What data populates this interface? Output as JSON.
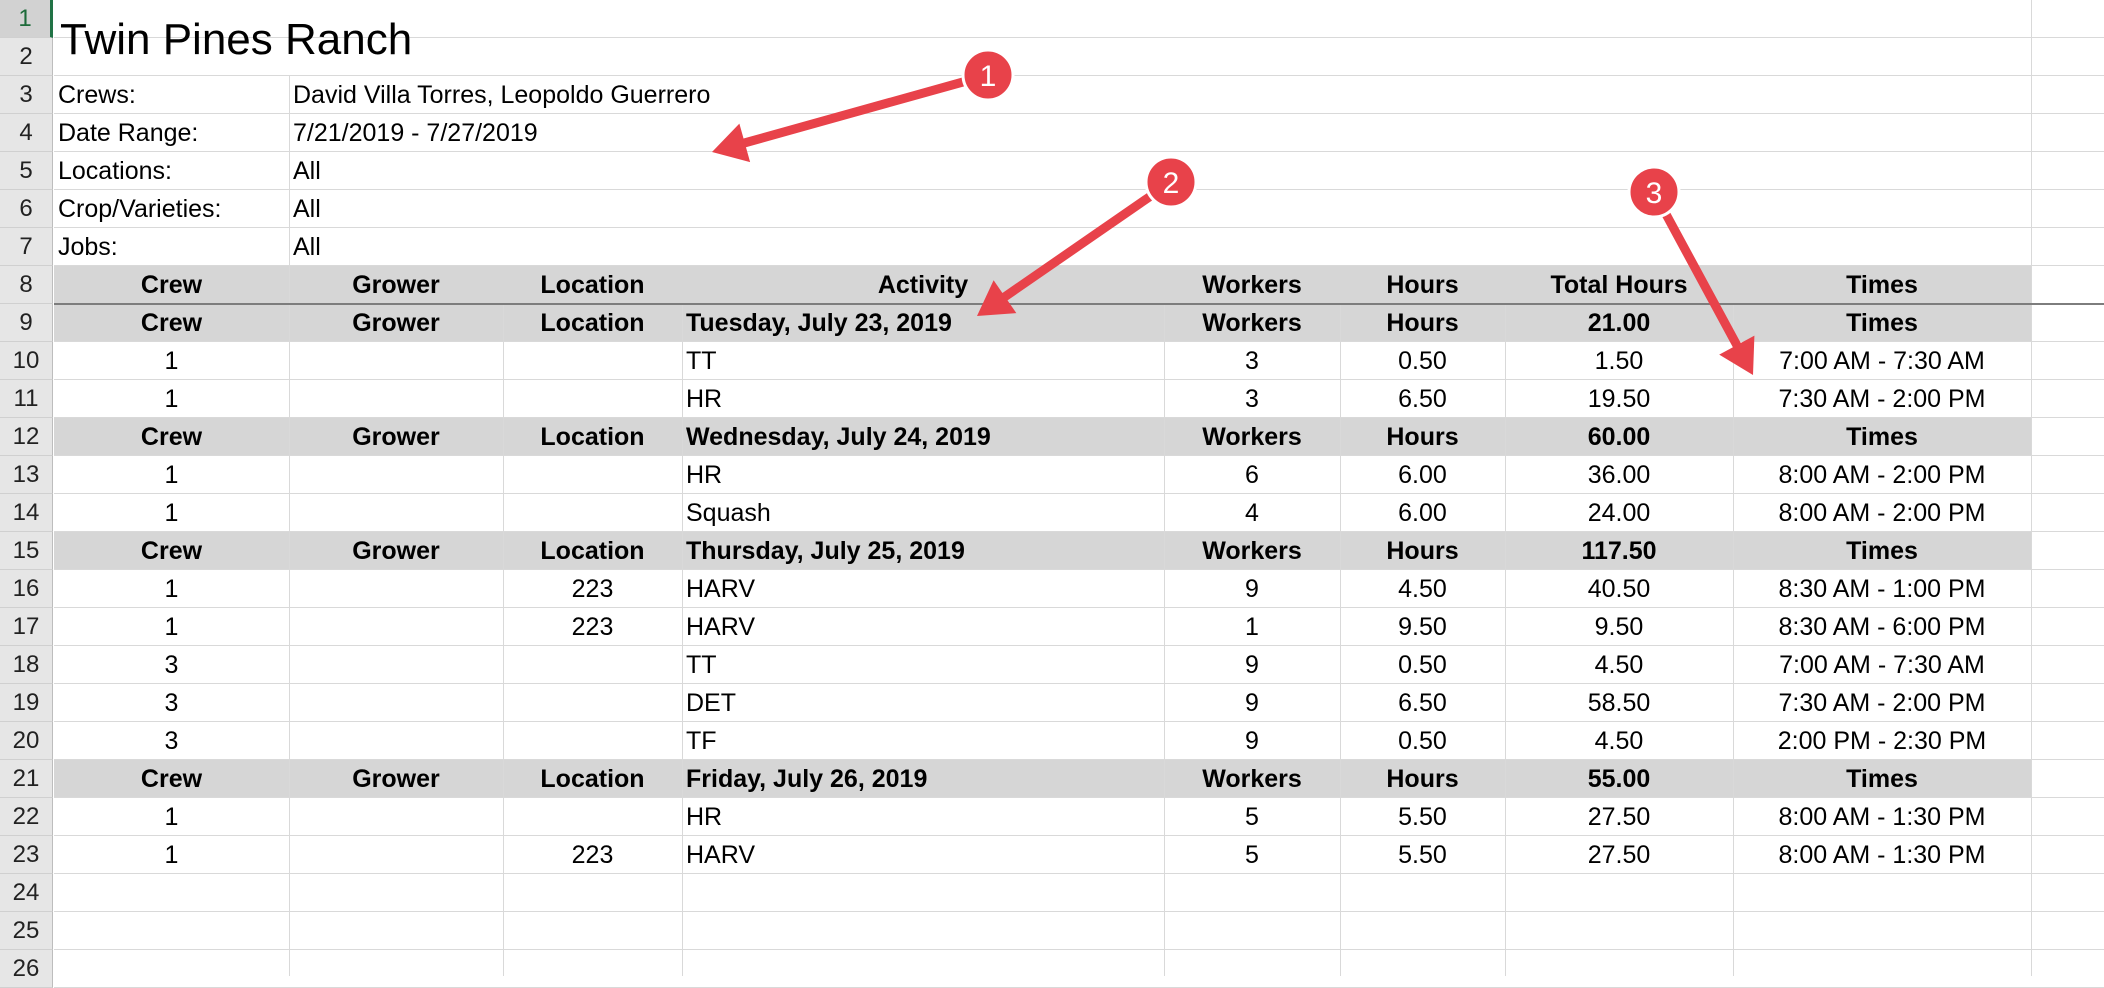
{
  "row_numbers": [
    "1",
    "2",
    "3",
    "4",
    "5",
    "6",
    "7",
    "8",
    "9",
    "10",
    "11",
    "12",
    "13",
    "14",
    "15",
    "16",
    "17",
    "18",
    "19",
    "20",
    "21",
    "22",
    "23",
    "24",
    "25",
    "26"
  ],
  "title": "Twin Pines Ranch",
  "info": [
    {
      "label": "Crews:",
      "value": "David Villa Torres, Leopoldo Guerrero"
    },
    {
      "label": "Date Range:",
      "value": "7/21/2019 - 7/27/2019"
    },
    {
      "label": "Locations:",
      "value": "All"
    },
    {
      "label": "Crop/Varieties:",
      "value": "All"
    },
    {
      "label": "Jobs:",
      "value": "All"
    }
  ],
  "columns": [
    "Crew",
    "Grower",
    "Location",
    "Activity",
    "Workers",
    "Hours",
    "Total Hours",
    "Times"
  ],
  "days": [
    {
      "header": [
        "Crew",
        "Grower",
        "Location",
        "Tuesday, July 23, 2019",
        "Workers",
        "Hours",
        "21.00",
        "Times"
      ],
      "rows": [
        [
          "1",
          "",
          "",
          "TT",
          "3",
          "0.50",
          "1.50",
          "7:00 AM - 7:30 AM"
        ],
        [
          "1",
          "",
          "",
          "HR",
          "3",
          "6.50",
          "19.50",
          "7:30 AM - 2:00 PM"
        ]
      ]
    },
    {
      "header": [
        "Crew",
        "Grower",
        "Location",
        "Wednesday, July 24, 2019",
        "Workers",
        "Hours",
        "60.00",
        "Times"
      ],
      "rows": [
        [
          "1",
          "",
          "",
          "HR",
          "6",
          "6.00",
          "36.00",
          "8:00 AM - 2:00 PM"
        ],
        [
          "1",
          "",
          "",
          "Squash",
          "4",
          "6.00",
          "24.00",
          "8:00 AM - 2:00 PM"
        ]
      ]
    },
    {
      "header": [
        "Crew",
        "Grower",
        "Location",
        "Thursday, July 25, 2019",
        "Workers",
        "Hours",
        "117.50",
        "Times"
      ],
      "rows": [
        [
          "1",
          "",
          "223",
          "HARV",
          "9",
          "4.50",
          "40.50",
          "8:30 AM - 1:00 PM"
        ],
        [
          "1",
          "",
          "223",
          "HARV",
          "1",
          "9.50",
          "9.50",
          "8:30 AM - 6:00 PM"
        ],
        [
          "3",
          "",
          "",
          "TT",
          "9",
          "0.50",
          "4.50",
          "7:00 AM - 7:30 AM"
        ],
        [
          "3",
          "",
          "",
          "DET",
          "9",
          "6.50",
          "58.50",
          "7:30 AM - 2:00 PM"
        ],
        [
          "3",
          "",
          "",
          "TF",
          "9",
          "0.50",
          "4.50",
          "2:00 PM - 2:30 PM"
        ]
      ]
    },
    {
      "header": [
        "Crew",
        "Grower",
        "Location",
        "Friday, July 26, 2019",
        "Workers",
        "Hours",
        "55.00",
        "Times"
      ],
      "rows": [
        [
          "1",
          "",
          "",
          "HR",
          "5",
          "5.50",
          "27.50",
          "8:00 AM - 1:30 PM"
        ],
        [
          "1",
          "",
          "223",
          "HARV",
          "5",
          "5.50",
          "27.50",
          "8:00 AM - 1:30 PM"
        ]
      ]
    }
  ],
  "annotations": [
    {
      "number": "1",
      "color": "#e8424a"
    },
    {
      "number": "2",
      "color": "#e8424a"
    },
    {
      "number": "3",
      "color": "#e8424a"
    }
  ],
  "colors": {
    "band": "#d6d6d6",
    "grid": "#d9d9d9",
    "selected_row_accent": "#217346",
    "annotation": "#e8424a"
  }
}
